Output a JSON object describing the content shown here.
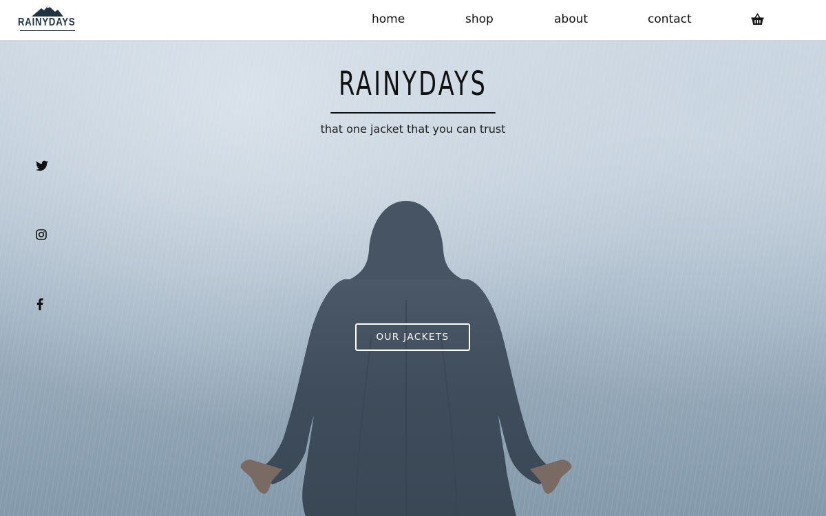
{
  "header": {
    "logo_text": "RAINYDAYS",
    "nav": [
      {
        "label": "home"
      },
      {
        "label": "shop"
      },
      {
        "label": "about"
      },
      {
        "label": "contact"
      }
    ],
    "cart_icon": "basket-icon"
  },
  "hero": {
    "title": "RAINYDAYS",
    "tagline": "that one jacket that you can trust",
    "cta_label": "OUR JACKETS",
    "social_icons": [
      "twitter-icon",
      "instagram-icon",
      "facebook-icon"
    ]
  },
  "colors": {
    "header_bg": "#ffffff",
    "text_dark": "#111111",
    "logo": "#1f3340",
    "cta_border": "#ffffff",
    "hero_sky": "#b9c7d3",
    "figure": "#3f4d5c"
  }
}
